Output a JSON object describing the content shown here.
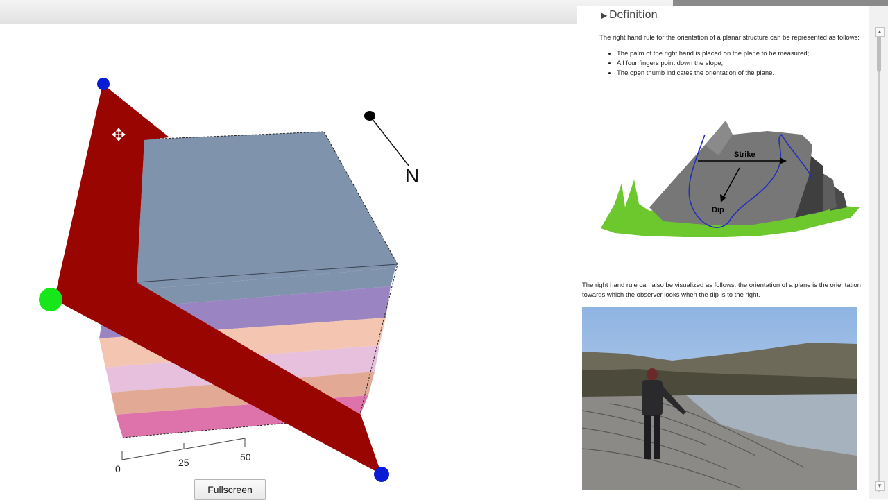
{
  "viewer": {
    "north_label": "N",
    "scale_ticks": [
      "0",
      "25",
      "50"
    ],
    "fullscreen_label": "Fullscreen"
  },
  "definition": {
    "title": "Definition",
    "intro": "The right hand rule for the orientation of a planar structure can be represented as follows:",
    "rules": [
      "The palm of the right hand is placed on the plane to be measured;",
      "All four fingers point down the slope;",
      "The open thumb indicates the orientation of the plane."
    ],
    "figure_labels": {
      "strike": "Strike",
      "dip": "Dip"
    },
    "visual_text": "The right hand rule can also be visualized as follows: the orientation of a plane is the orientation towards which the observer looks when the dip is to the right."
  },
  "colors": {
    "plane": "#990500",
    "block_top": "#7f93ad",
    "layers": [
      "#7f93ad",
      "#9b84c2",
      "#f4c6b2",
      "#e6c0dc",
      "#e2a995",
      "#de72ab"
    ],
    "handle_blue": "#0a1bd6",
    "handle_green": "#17e61a"
  }
}
